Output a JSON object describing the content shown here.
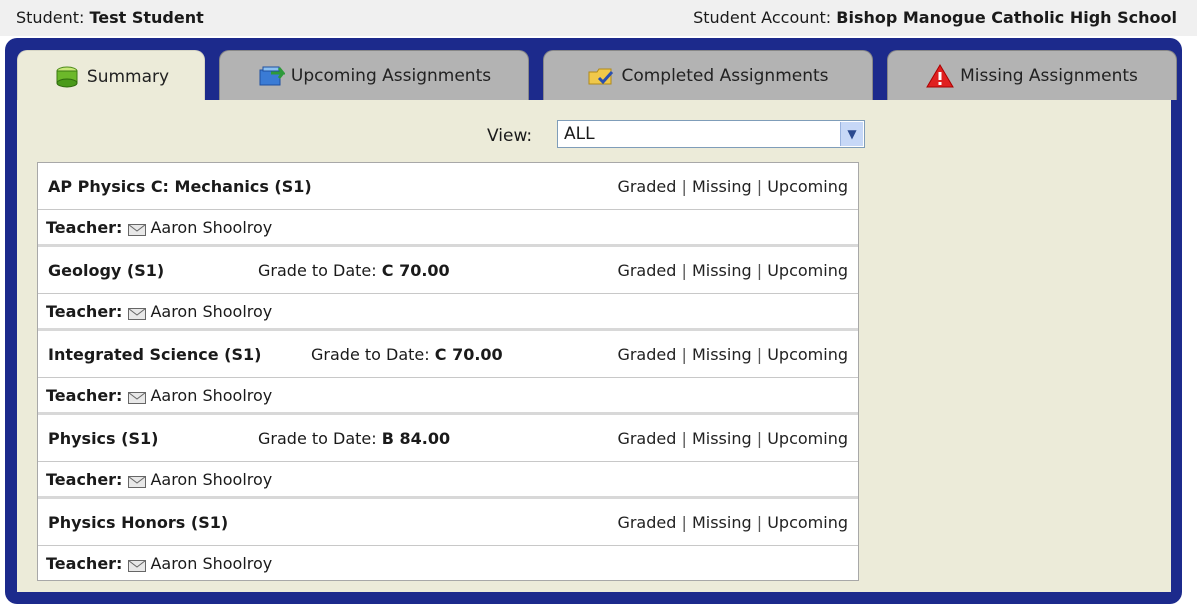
{
  "header": {
    "student_label": "Student:",
    "student_name": "Test Student",
    "account_label": "Student Account:",
    "account_name": "Bishop Manogue Catholic High School"
  },
  "tabs": [
    {
      "label": "Summary",
      "icon": "summary-icon",
      "active": true
    },
    {
      "label": "Upcoming Assignments",
      "icon": "upcoming-icon",
      "active": false
    },
    {
      "label": "Completed Assignments",
      "icon": "completed-icon",
      "active": false
    },
    {
      "label": "Missing Assignments",
      "icon": "missing-warning-icon",
      "active": false
    }
  ],
  "view": {
    "label": "View:",
    "selected": "ALL"
  },
  "links": {
    "graded": "Graded",
    "missing": "Missing",
    "upcoming": "Upcoming",
    "separator": "|"
  },
  "teacher_label": "Teacher:",
  "grade_label": "Grade to Date:",
  "courses": [
    {
      "name": "AP Physics C: Mechanics (S1)",
      "grade": "",
      "teacher": "Aaron Shoolroy"
    },
    {
      "name": "Geology (S1)",
      "grade": "C 70.00",
      "teacher": "Aaron Shoolroy"
    },
    {
      "name": "Integrated Science (S1)",
      "grade": "C 70.00",
      "teacher": "Aaron Shoolroy"
    },
    {
      "name": "Physics (S1)",
      "grade": "B 84.00",
      "teacher": "Aaron Shoolroy"
    },
    {
      "name": "Physics Honors (S1)",
      "grade": "",
      "teacher": "Aaron Shoolroy"
    }
  ],
  "colors": {
    "frame": "#1c2a8c",
    "panel": "#ecebd9",
    "tab_inactive": "#b3b3b3"
  }
}
